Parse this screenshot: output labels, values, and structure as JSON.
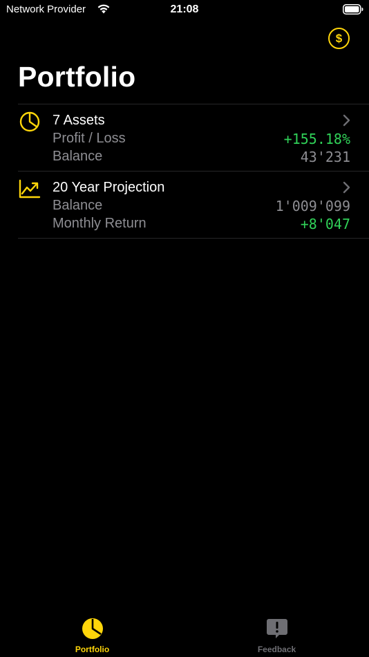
{
  "status_bar": {
    "carrier": "Network Provider",
    "time": "21:08"
  },
  "header": {
    "currency_symbol": "$",
    "title": "Portfolio"
  },
  "rows": [
    {
      "icon": "pie-chart-icon",
      "title": "7 Assets",
      "line1_label": "Profit / Loss",
      "line1_value": "+155.18%",
      "line2_label": "Balance",
      "line2_value": "43'231"
    },
    {
      "icon": "trend-up-icon",
      "title": "20 Year Projection",
      "line1_label": "Balance",
      "line1_value": "1'009'099",
      "line2_label": "Monthly Return",
      "line2_value": "+8'047"
    }
  ],
  "tabs": [
    {
      "label": "Portfolio",
      "icon": "pie-chart-icon",
      "active": true
    },
    {
      "label": "Feedback",
      "icon": "feedback-bubble-icon",
      "active": false
    }
  ],
  "colors": {
    "accent": "#FFD60A",
    "positive": "#30D158",
    "secondary_text": "#8e8e93",
    "separator": "#262628",
    "background": "#000000"
  }
}
